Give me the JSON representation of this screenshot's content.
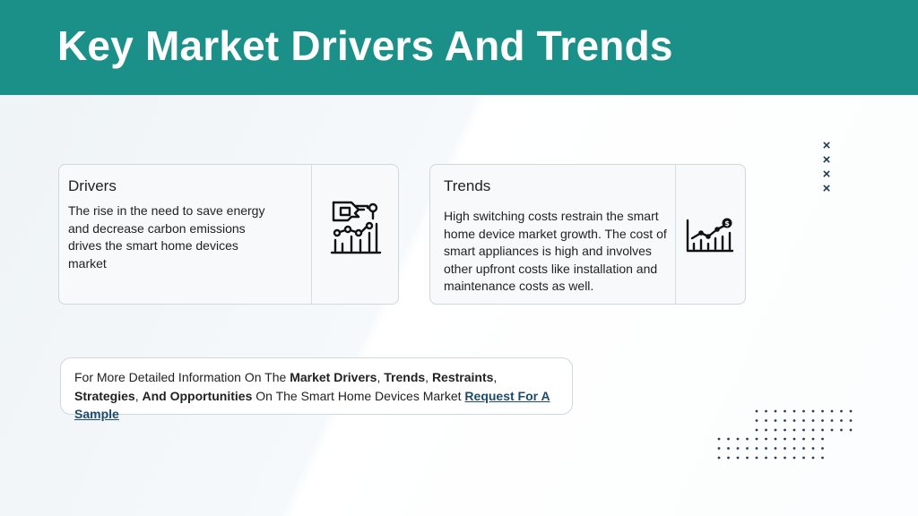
{
  "header": {
    "title": "Key Market Drivers And Trends",
    "color": "#1a9088"
  },
  "drivers": {
    "title": "Drivers",
    "text": "The rise in the need to save energy and decrease carbon emissions drives the smart home devices market",
    "icon": "smart-hand-chart-icon"
  },
  "trends": {
    "title": "Trends",
    "text": "High switching costs restrain the smart home device market growth. The cost of smart appliances is high and involves other upfront costs like installation and maintenance costs as well.",
    "icon": "money-growth-chart-icon"
  },
  "info": {
    "prefix": "For More Detailed Information On The ",
    "b1": "Market Drivers",
    "sep1": ", ",
    "b2": "Trends",
    "sep2": ", ",
    "b3": "Restraints",
    "sep3": ", ",
    "b4": "Strategies",
    "sep4": ", ",
    "b5": "And Opportunities",
    "suffix": " On The Smart Home Devices Market  ",
    "link": "Request For A Sample"
  },
  "decor": {
    "x_mark": "×",
    "accent": "#1d3a57"
  }
}
